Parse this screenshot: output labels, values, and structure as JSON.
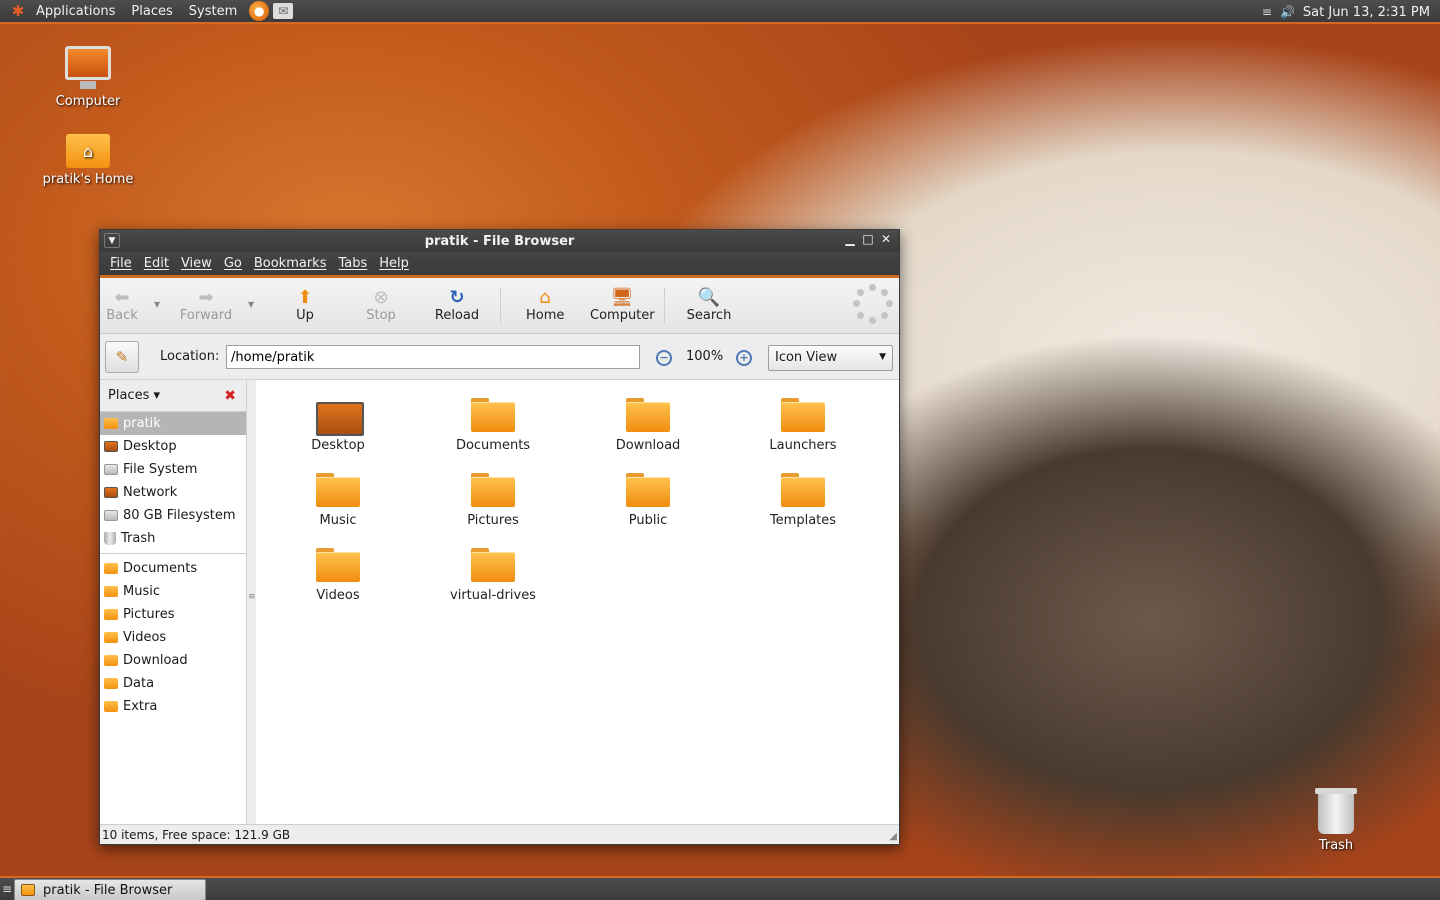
{
  "top_panel": {
    "menus": [
      "Applications",
      "Places",
      "System"
    ],
    "clock": "Sat Jun 13,  2:31 PM"
  },
  "desktop": {
    "icons": [
      {
        "label": "Computer"
      },
      {
        "label": "pratik's Home"
      },
      {
        "label": "Trash"
      }
    ]
  },
  "window": {
    "title": "pratik - File Browser",
    "menubar": [
      "File",
      "Edit",
      "View",
      "Go",
      "Bookmarks",
      "Tabs",
      "Help"
    ],
    "toolbar": {
      "back": "Back",
      "forward": "Forward",
      "up": "Up",
      "stop": "Stop",
      "reload": "Reload",
      "home": "Home",
      "computer": "Computer",
      "search": "Search"
    },
    "location": {
      "label": "Location:",
      "value": "/home/pratik",
      "zoom": "100%",
      "view_mode": "Icon View"
    },
    "sidebar": {
      "header": "Places ▾",
      "places": [
        {
          "label": "pratik",
          "selected": true
        },
        {
          "label": "Desktop"
        },
        {
          "label": "File System"
        },
        {
          "label": "Network"
        },
        {
          "label": "80 GB Filesystem"
        },
        {
          "label": "Trash"
        }
      ],
      "bookmarks": [
        "Documents",
        "Music",
        "Pictures",
        "Videos",
        "Download",
        "Data",
        "Extra"
      ]
    },
    "files": [
      "Desktop",
      "Documents",
      "Download",
      "Launchers",
      "Music",
      "Pictures",
      "Public",
      "Templates",
      "Videos",
      "virtual-drives"
    ],
    "status": "10 items, Free space: 121.9 GB"
  },
  "taskbar": {
    "task": "pratik - File Browser"
  },
  "colors": {
    "accent": "#d46a1f",
    "folder": "#f29111",
    "panel": "#3b3b3b"
  }
}
